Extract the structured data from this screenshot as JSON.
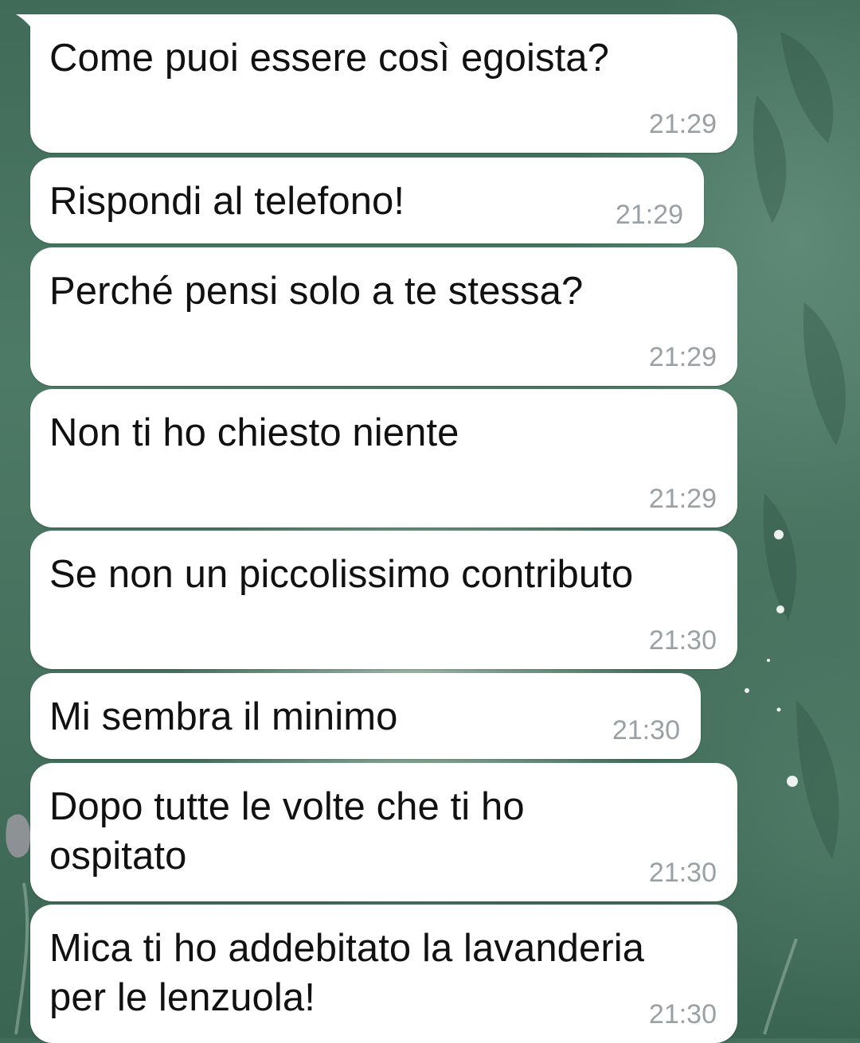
{
  "messages": [
    {
      "text": "Come puoi essere così egoista?",
      "time": "21:29"
    },
    {
      "text": "Rispondi al telefono!",
      "time": "21:29"
    },
    {
      "text": "Perché pensi solo a te stessa?",
      "time": "21:29"
    },
    {
      "text": "Non ti ho chiesto niente",
      "time": "21:29"
    },
    {
      "text": "Se non un piccolissimo contributo",
      "time": "21:30"
    },
    {
      "text": "Mi sembra il minimo",
      "time": "21:30"
    },
    {
      "text": "Dopo tutte le volte che ti ho\nospitato",
      "time": "21:30"
    },
    {
      "text": "Mica ti ho addebitato la lavanderia\nper le lenzuola!",
      "time": "21:30"
    }
  ],
  "colors": {
    "bubble_bg": "#ffffff",
    "text": "#111111",
    "timestamp": "#9aa0a4",
    "wallpaper": "#446f5c"
  }
}
